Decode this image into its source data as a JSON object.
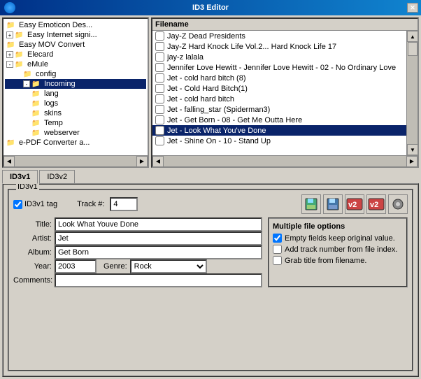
{
  "window": {
    "title": "ID3 Editor",
    "close_btn": "✕"
  },
  "tree": {
    "items": [
      {
        "label": "Easy Emoticon Des...",
        "indent": 0,
        "has_expand": false
      },
      {
        "label": "Easy Internet signi...",
        "indent": 0,
        "has_expand": true
      },
      {
        "label": "Easy MOV Convert",
        "indent": 0,
        "has_expand": false
      },
      {
        "label": "Elecard",
        "indent": 0,
        "has_expand": true
      },
      {
        "label": "eMule",
        "indent": 0,
        "has_expand": true,
        "expanded": true
      },
      {
        "label": "config",
        "indent": 1,
        "has_expand": false
      },
      {
        "label": "Incoming",
        "indent": 1,
        "has_expand": true,
        "expanded": true,
        "selected": true
      },
      {
        "label": "lang",
        "indent": 2,
        "has_expand": false
      },
      {
        "label": "logs",
        "indent": 2,
        "has_expand": false
      },
      {
        "label": "skins",
        "indent": 2,
        "has_expand": false
      },
      {
        "label": "Temp",
        "indent": 2,
        "has_expand": false
      },
      {
        "label": "webserver",
        "indent": 2,
        "has_expand": false
      },
      {
        "label": "e-PDF Converter a...",
        "indent": 0,
        "has_expand": false
      }
    ]
  },
  "file_list": {
    "header": "Filename",
    "items": [
      {
        "name": "Jay-Z Dead Presidents",
        "checked": false,
        "selected": false
      },
      {
        "name": "Jay-Z Hard Knock Life Vol.2... Hard Knock Life 17",
        "checked": false,
        "selected": false
      },
      {
        "name": "jay-z lalala",
        "checked": false,
        "selected": false
      },
      {
        "name": "Jennifer Love Hewitt - Jennifer Love Hewitt - 02 - No Ordinary Love",
        "checked": false,
        "selected": false
      },
      {
        "name": "Jet - cold hard bitch (8)",
        "checked": false,
        "selected": false
      },
      {
        "name": "Jet - Cold Hard Bitch(1)",
        "checked": false,
        "selected": false
      },
      {
        "name": "Jet - cold hard bitch",
        "checked": false,
        "selected": false
      },
      {
        "name": "Jet - falling_star (Spiderman3)",
        "checked": false,
        "selected": false
      },
      {
        "name": "Jet - Get Born - 08 - Get Me Outta Here",
        "checked": false,
        "selected": false
      },
      {
        "name": "Jet - Look What You've Done",
        "checked": false,
        "selected": true
      },
      {
        "name": "Jet - Shine On - 10 - Stand Up",
        "checked": false,
        "selected": false
      }
    ]
  },
  "tabs": [
    {
      "label": "ID3v1",
      "active": true
    },
    {
      "label": "ID3v2",
      "active": false
    }
  ],
  "id3v1": {
    "label": "ID3v1",
    "checkbox_label": "ID3v1 tag",
    "track_label": "Track #:",
    "track_value": "4",
    "fields": {
      "title_label": "Title:",
      "title_value": "Look What Youve Done",
      "artist_label": "Artist:",
      "artist_value": "Jet",
      "album_label": "Album:",
      "album_value": "Get Born",
      "year_label": "Year:",
      "year_value": "2003",
      "genre_label": "Genre:",
      "genre_value": "Rock",
      "comments_label": "Comments:",
      "comments_value": ""
    },
    "multiple_options": {
      "title": "Multiple file options",
      "options": [
        {
          "label": "Empty fields keep original value.",
          "checked": true
        },
        {
          "label": "Add track number from file index.",
          "checked": false
        },
        {
          "label": "Grab title from filename.",
          "checked": false
        }
      ]
    }
  }
}
